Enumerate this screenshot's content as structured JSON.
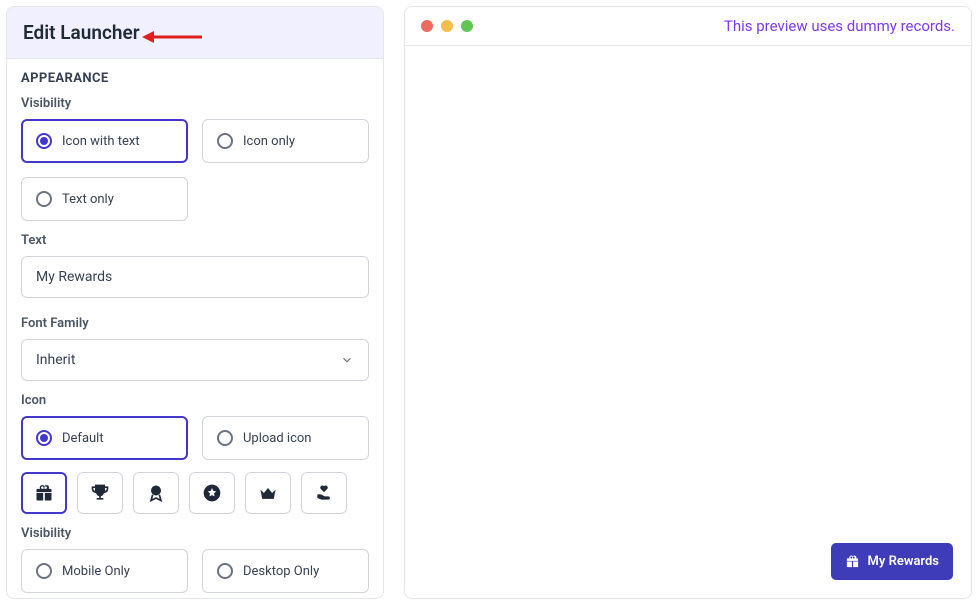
{
  "panel": {
    "title": "Edit Launcher",
    "section_appearance": "APPEARANCE",
    "visibility_label": "Visibility",
    "visibility_options": [
      {
        "label": "Icon with text",
        "selected": true
      },
      {
        "label": "Icon only",
        "selected": false
      },
      {
        "label": "Text only",
        "selected": false
      }
    ],
    "text_label": "Text",
    "text_value": "My Rewards",
    "font_label": "Font Family",
    "font_value": "Inherit",
    "icon_label": "Icon",
    "icon_source_options": [
      {
        "label": "Default",
        "selected": true
      },
      {
        "label": "Upload icon",
        "selected": false
      }
    ],
    "icons": [
      "gift",
      "trophy",
      "medal",
      "star-circle",
      "crown",
      "hand-heart"
    ],
    "selected_icon": "gift",
    "device_label": "Visibility",
    "device_options": [
      {
        "label": "Mobile Only",
        "selected": false
      },
      {
        "label": "Desktop Only",
        "selected": false
      }
    ]
  },
  "preview": {
    "note": "This preview uses dummy records.",
    "launcher_text": "My Rewards"
  },
  "colors": {
    "accent": "#4338ca",
    "launcher": "#3f3cba",
    "preview_text": "#7c3aed"
  }
}
